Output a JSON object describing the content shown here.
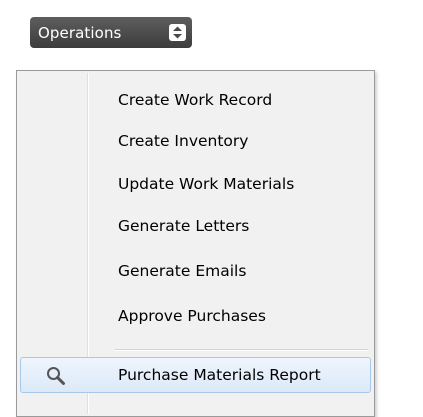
{
  "operations_button": {
    "label": "Operations",
    "icon": "updown-arrows-icon"
  },
  "menu": {
    "items": [
      {
        "label": "Create Work Record"
      },
      {
        "label": "Create Inventory"
      },
      {
        "label": "Update Work Materials"
      },
      {
        "label": "Generate Letters"
      },
      {
        "label": "Generate Emails"
      },
      {
        "label": "Approve Purchases"
      }
    ],
    "highlighted_item": {
      "label": "Purchase Materials Report",
      "icon": "magnifier-icon"
    }
  },
  "colors": {
    "button_bg": "#4a4a4a",
    "menu_bg": "#f1f1f1",
    "hover_bg": "#dde9f8",
    "hover_border": "#a8c8ea"
  }
}
